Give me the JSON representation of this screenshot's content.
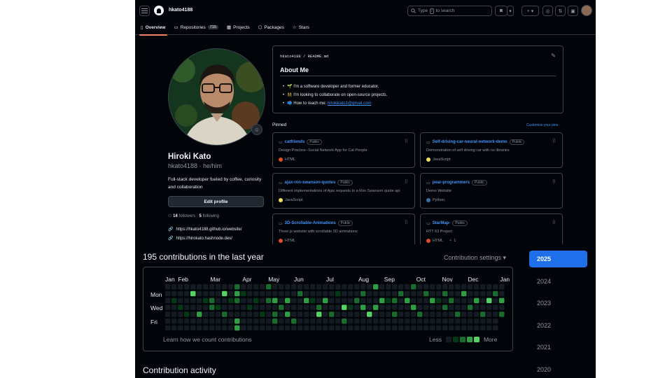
{
  "header": {
    "username": "hkato4188",
    "search_placeholder_pre": "Type",
    "search_key": "/",
    "search_placeholder_post": "to search"
  },
  "tabs": [
    {
      "label": "Overview",
      "icon": "book-icon",
      "selected": true
    },
    {
      "label": "Repositories",
      "count": "715",
      "icon": "repo-icon"
    },
    {
      "label": "Projects",
      "icon": "table-icon"
    },
    {
      "label": "Packages",
      "icon": "package-icon"
    },
    {
      "label": "Stars",
      "icon": "star-icon"
    }
  ],
  "profile": {
    "name": "Hiroki Kato",
    "login_line": "hkato4188 · he/him",
    "bio": "Full-stack developer fueled by coffee, curiosity and collaboration",
    "edit_label": "Edit profile",
    "followers": "14",
    "followers_label": "followers",
    "following": "5",
    "following_label": "following",
    "links": [
      "https://hkato4188.github.io/website/",
      "https://hirokato.hashnode.dev/"
    ]
  },
  "readme": {
    "path": "hkato4188 / README.md",
    "title": "About Me",
    "items": [
      {
        "emoji": "🌱",
        "text": "I'm a software developer and former educator."
      },
      {
        "emoji": "👯",
        "text": "I'm looking to collaborate on open-source projects."
      },
      {
        "emoji": "📫",
        "text": "How to reach me: ",
        "link": "hirokikato1@gmail.com"
      }
    ]
  },
  "pinned": {
    "title": "Pinned",
    "customize": "Customize your pins",
    "badge": "Public",
    "cards": [
      {
        "name": "catfriends",
        "desc": "Design Practice--Social Network App for Cat People",
        "lang": "HTML",
        "color": "#e34c26"
      },
      {
        "name": "Self-driving-car-neural-network-demo",
        "desc": "Demonstration of self driving car with no libraries",
        "lang": "JavaScript",
        "color": "#f1e05a"
      },
      {
        "name": "ajax-ron-swanson-quotes",
        "desc": "Different implementations of Ajax requests to a Ron Swanson quote api",
        "lang": "JavaScript",
        "color": "#f1e05a"
      },
      {
        "name": "pear-programmers",
        "desc": "Demo Website",
        "lang": "Python",
        "color": "#3572A5"
      },
      {
        "name": "3D-Scrollable-Animations",
        "desc": "Three.js website with scrollable 3D animations",
        "lang": "HTML",
        "color": "#e34c26"
      },
      {
        "name": "StarMap-",
        "desc": "RTT 63 Project",
        "lang": "HTML",
        "color": "#e34c26",
        "forks": "1"
      }
    ]
  },
  "contributions": {
    "title": "195 contributions in the last year",
    "settings": "Contribution settings ▾",
    "months": [
      "Jan",
      "Feb",
      "Mar",
      "Apr",
      "May",
      "Jun",
      "Jul",
      "Aug",
      "Sep",
      "Oct",
      "Nov",
      "Dec",
      "Jan"
    ],
    "month_weeks": [
      0,
      2,
      7,
      12,
      16,
      20,
      25,
      30,
      34,
      39,
      43,
      47,
      52
    ],
    "day_labels": [
      "Mon",
      "Wed",
      "Fri"
    ],
    "learn": "Learn how we count contributions",
    "less": "Less",
    "more": "More",
    "colors": [
      "#151b23",
      "#033a16",
      "#196c2e",
      "#2ea043",
      "#56d364"
    ]
  },
  "years": [
    "2025",
    "2024",
    "2023",
    "2022",
    "2021",
    "2020"
  ],
  "selected_year": "2025",
  "activity_title": "Contribution activity"
}
